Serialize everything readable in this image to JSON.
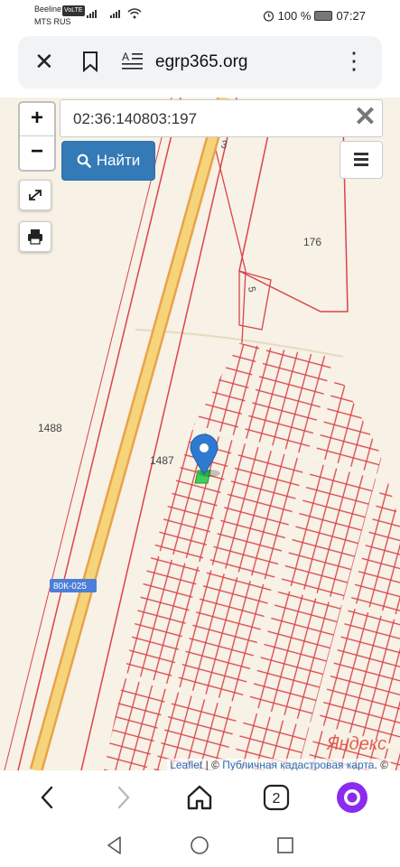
{
  "status_bar": {
    "carrier1": "Beeline",
    "lte_badge": "VoLTE",
    "carrier2": "MTS RUS",
    "battery": "100 %",
    "time": "07:27"
  },
  "address_bar": {
    "url": "egrp365.org"
  },
  "map": {
    "search_value": "02:36:140803:197",
    "find_label": "Найти",
    "zoom_in": "+",
    "zoom_out": "−",
    "labels": {
      "road_number_top": "3",
      "parcel_176": "176",
      "parcel_5": "5",
      "parcel_1488": "1488",
      "parcel_1487": "1487",
      "road_badge": "80К-025",
      "yandex_logo": "Яндекс"
    },
    "attribution": {
      "leaflet": "Leaflet",
      "sep": " | © ",
      "pkk": "Публичная кадастровая карта",
      "suffix": ". ©"
    }
  },
  "bottom_nav": {
    "tab_count": "2"
  },
  "colors": {
    "parcel_stroke": "#d9444a",
    "road": "#f2c15a",
    "marker": "#2f7ad1",
    "selected_parcel": "#3ecf5a",
    "find_button": "#337ab7"
  }
}
